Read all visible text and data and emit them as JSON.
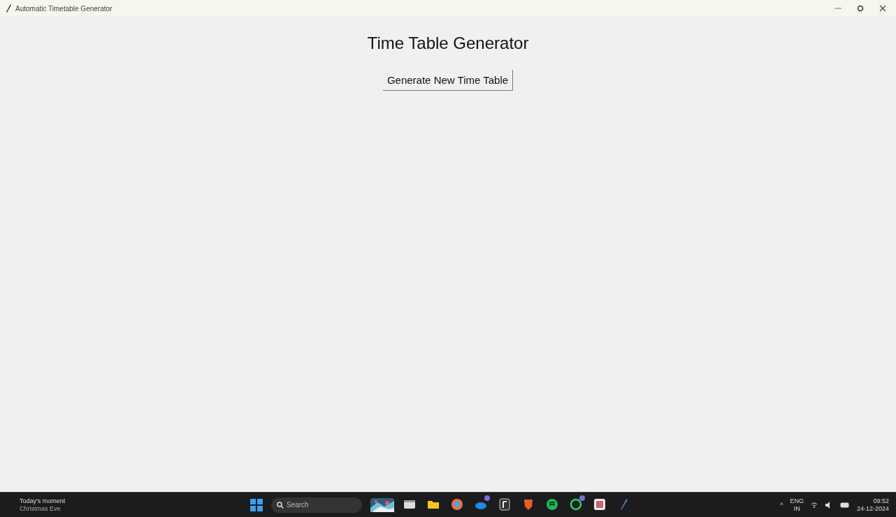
{
  "window": {
    "title": "Automatic Timetable Generator",
    "heading": "Time Table Generator",
    "button": "Generate New Time Table"
  },
  "taskbar": {
    "widget": {
      "title": "Today's moment",
      "subtitle": "Christmas Eve"
    },
    "search": {
      "placeholder": "Search"
    },
    "apps": [
      {
        "kind": "window",
        "badge": false
      },
      {
        "kind": "folder",
        "badge": false
      },
      {
        "kind": "copilot",
        "badge": false
      },
      {
        "kind": "cloud",
        "badge": true
      },
      {
        "kind": "notes",
        "badge": false
      },
      {
        "kind": "shield",
        "badge": false
      },
      {
        "kind": "music",
        "badge": false
      },
      {
        "kind": "chat",
        "badge": true
      },
      {
        "kind": "grid",
        "badge": false
      },
      {
        "kind": "feather",
        "badge": false
      }
    ],
    "tray": {
      "overflow": "^",
      "language": "ENG",
      "region": "IN",
      "time": "09:52",
      "date": "24-12-2024"
    }
  }
}
